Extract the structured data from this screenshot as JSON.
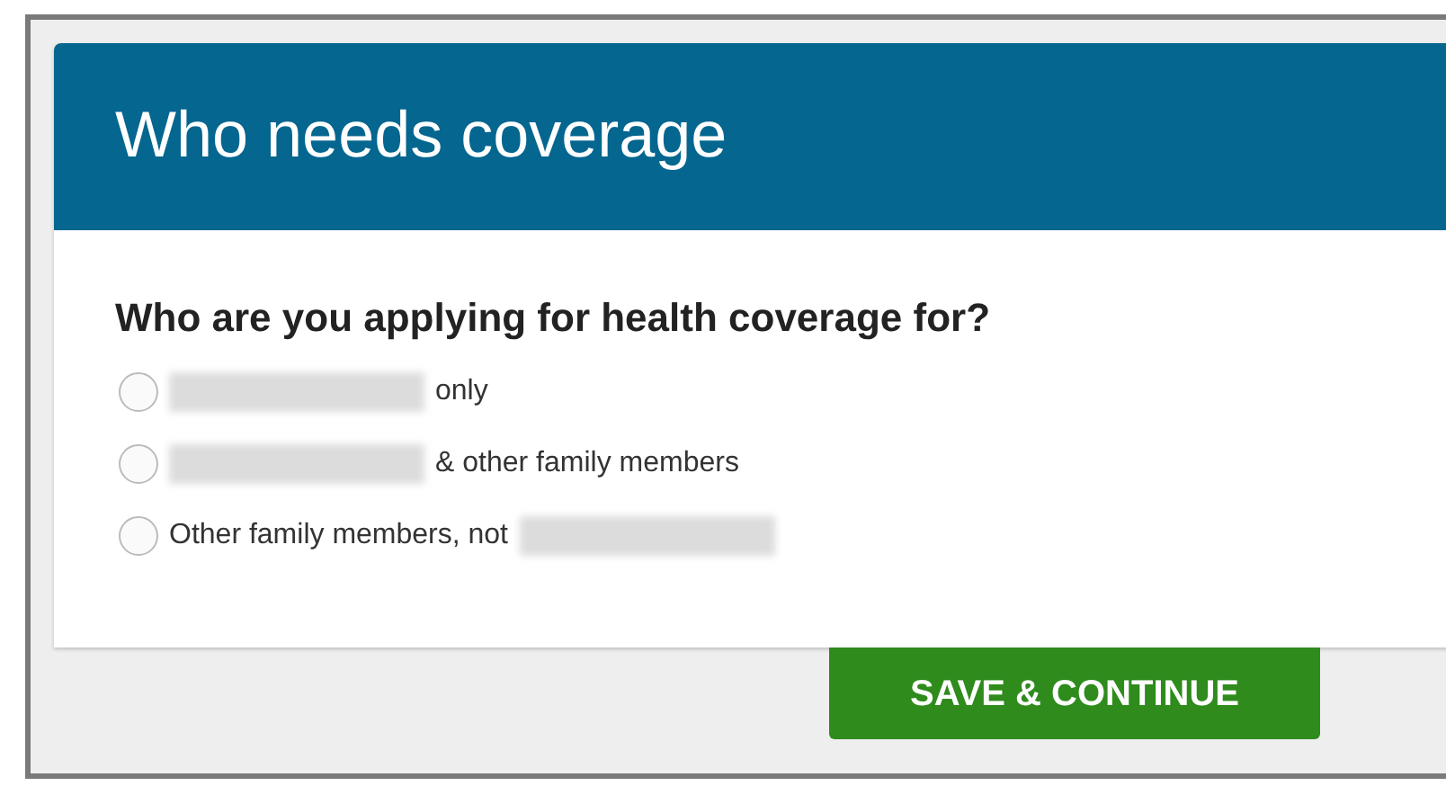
{
  "header": {
    "title": "Who needs coverage"
  },
  "question": "Who are you applying for health coverage for?",
  "options": [
    {
      "selected": false,
      "parts": [
        {
          "kind": "redacted"
        },
        {
          "kind": "text",
          "text": "only"
        }
      ]
    },
    {
      "selected": false,
      "parts": [
        {
          "kind": "redacted"
        },
        {
          "kind": "text",
          "text": "& other family members"
        }
      ]
    },
    {
      "selected": false,
      "parts": [
        {
          "kind": "text",
          "text": "Other family members, not"
        },
        {
          "kind": "redacted"
        }
      ]
    }
  ],
  "button": {
    "label": "SAVE & CONTINUE"
  }
}
